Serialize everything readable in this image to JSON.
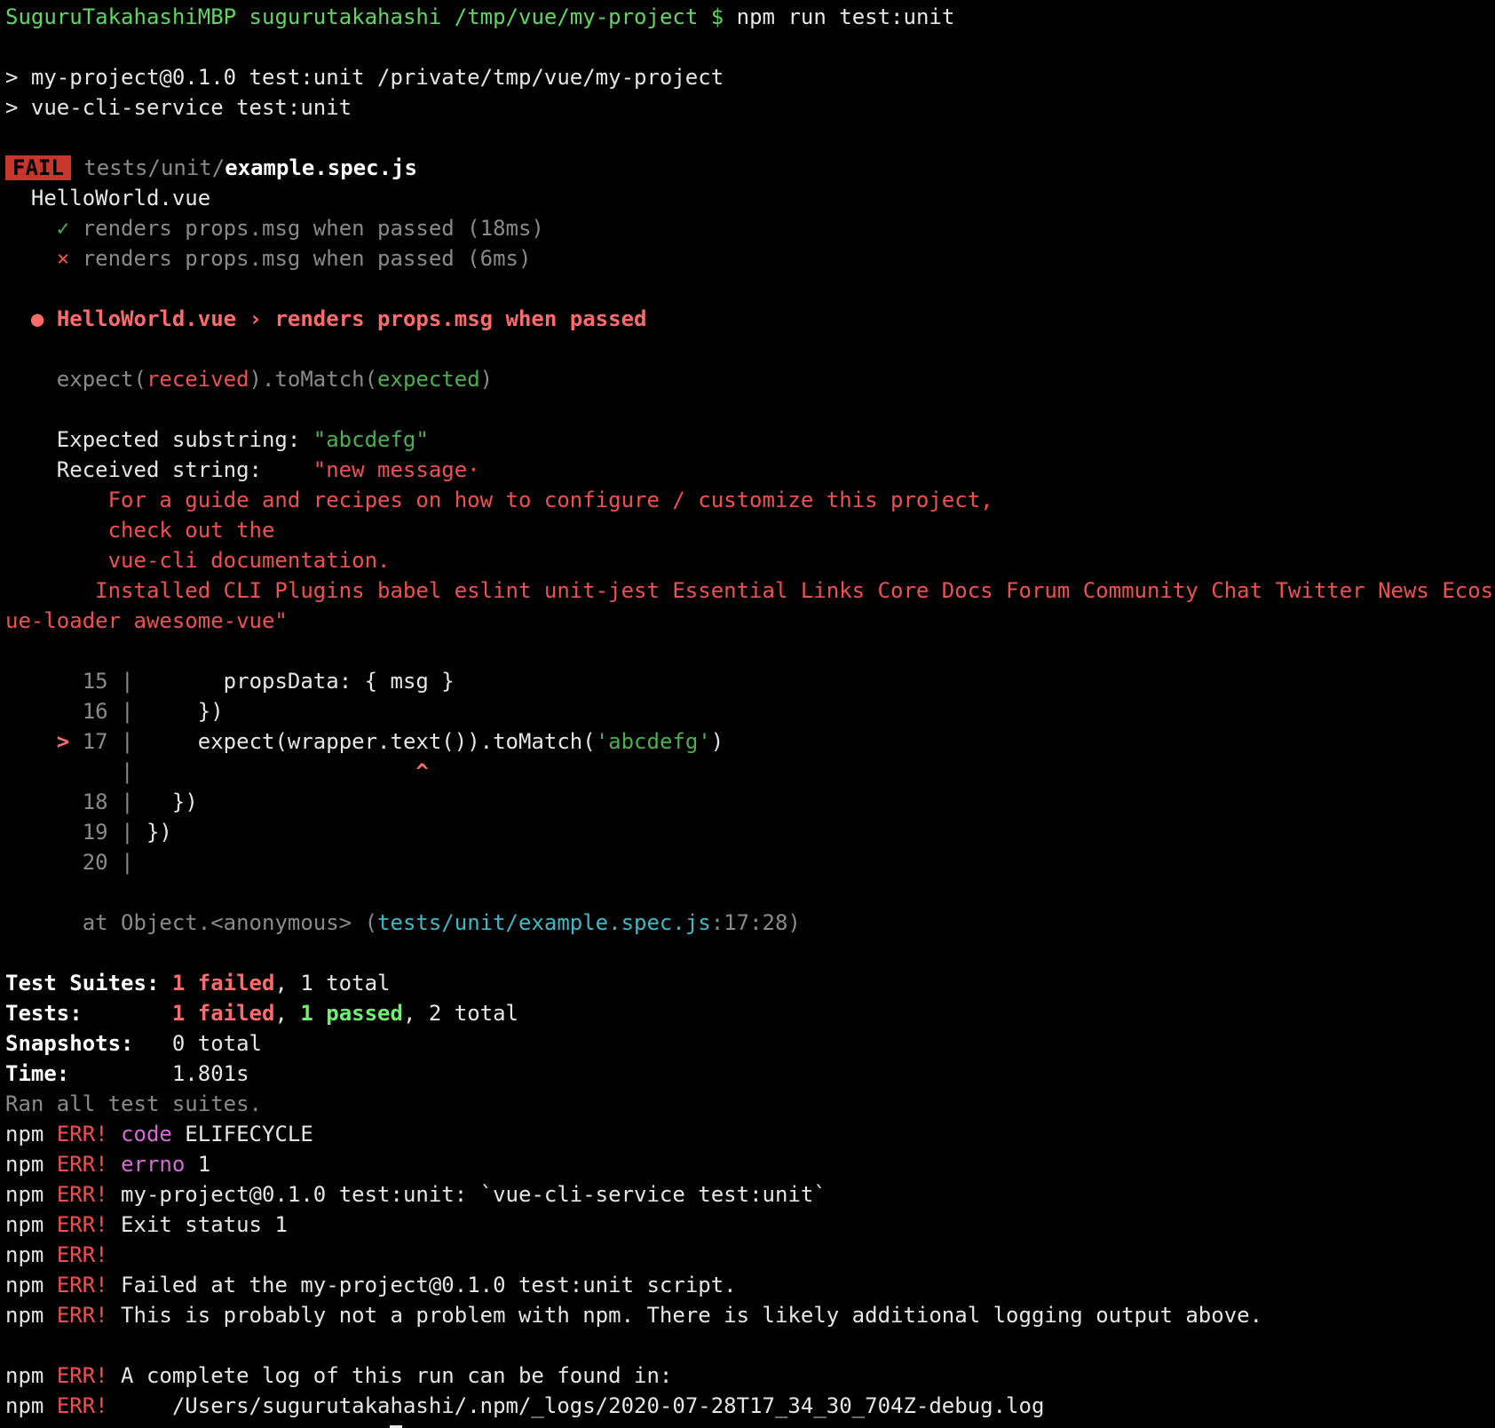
{
  "prompt": {
    "host": "SuguruTakahashiMBP",
    "user": "sugurutakahashi",
    "cwd": "/tmp/vue/my-project",
    "symbol": "$",
    "command": "npm run test:unit"
  },
  "script_header": [
    "> my-project@0.1.0 test:unit /private/tmp/vue/my-project",
    "> vue-cli-service test:unit"
  ],
  "suite": {
    "status": "FAIL",
    "path_dim": "tests/unit/",
    "file": "example.spec.js",
    "describe": "HelloWorld.vue",
    "tests": [
      {
        "mark": "✓",
        "text": "renders props.msg when passed (18ms)"
      },
      {
        "mark": "×",
        "text": "renders props.msg when passed (6ms)"
      }
    ]
  },
  "failure": {
    "bullet": "●",
    "title": "HelloWorld.vue › renders props.msg when passed",
    "matcher": {
      "expect": "expect(",
      "received": "received",
      "mid": ").toMatch(",
      "expected": "expected",
      "end": ")"
    },
    "expected_label": "Expected substring: ",
    "expected_value": "\"abcdefg\"",
    "received_label": "Received string:    ",
    "received_lines": [
      "\"new message·",
      "    For a guide and recipes on how to configure / customize this project,",
      "    check out the",
      "    vue-cli documentation.",
      "   Installed CLI Plugins babel eslint unit-jest Essential Links Core Docs Forum Community Chat Twitter News Ecosystem vue-router vuex vue-devtools v",
      "ue-loader awesome-vue\""
    ]
  },
  "code_frame": {
    "l15_num": "15",
    "l15_code": "      propsData: { msg }",
    "l16_num": "16",
    "l16_code": "    })",
    "l17_marker": ">",
    "l17_num": "17",
    "l17_code_a": "    expect(wrapper.text()).toMatch(",
    "l17_code_str": "'abcdefg'",
    "l17_code_b": ")",
    "caret": "^",
    "l18_num": "18",
    "l18_code": "  })",
    "l19_num": "19",
    "l19_code": "})",
    "l20_num": "20",
    "sep": "|"
  },
  "stack": {
    "prefix": "at Object.<anonymous> (",
    "link": "tests/unit/example.spec.js",
    "pos": ":17:28)"
  },
  "summary": {
    "suites_label": "Test Suites:",
    "suites_failed": "1 failed",
    "suites_total": ", 1 total",
    "tests_label": "Tests:",
    "tests_failed": "1 failed",
    "tests_passed": "1 passed",
    "tests_total": ", 2 total",
    "snap_label": "Snapshots:",
    "snap_value": "0 total",
    "time_label": "Time:",
    "time_value": "1.801s",
    "ran": "Ran all test suites."
  },
  "npm_err": {
    "npm": "npm",
    "err": "ERR!",
    "lines": [
      {
        "key": "code",
        "text": " ELIFECYCLE"
      },
      {
        "key": "errno",
        "text": " 1"
      },
      {
        "key": "",
        "text": " my-project@0.1.0 test:unit: `vue-cli-service test:unit`"
      },
      {
        "key": "",
        "text": " Exit status 1"
      },
      {
        "key": "",
        "text": ""
      },
      {
        "key": "",
        "text": " Failed at the my-project@0.1.0 test:unit script."
      },
      {
        "key": "",
        "text": " This is probably not a problem with npm. There is likely additional logging output above."
      }
    ],
    "log_lines": [
      " A complete log of this run can be found in:",
      "     /Users/sugurutakahashi/.npm/_logs/2020-07-28T17_34_30_704Z-debug.log"
    ]
  },
  "colors": {
    "background": "#000000",
    "prompt": "#5fd75f",
    "error": "#f05050",
    "pass": "#6cf26c",
    "link": "#3fb8c8",
    "key": "#d66bd6",
    "fail_badge": "#c8362b"
  }
}
